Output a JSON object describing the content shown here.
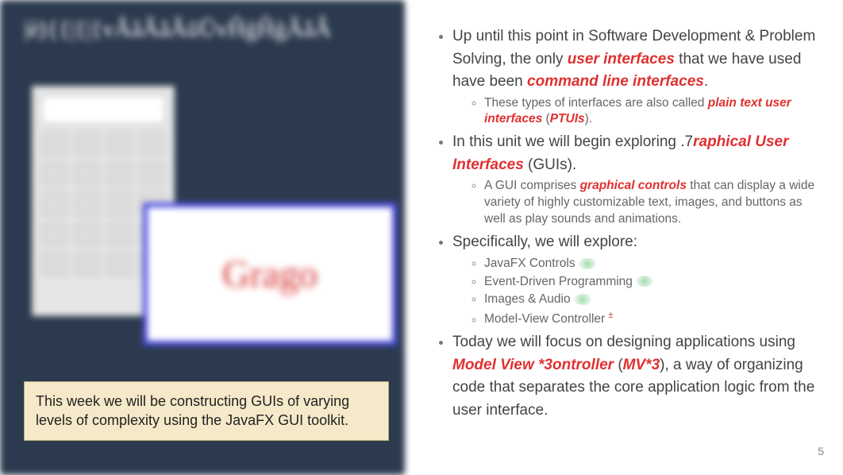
{
  "left": {
    "title": "|è⦆{{|{|{vĂăĂăĂūŪvĤģĤģĂăÂ",
    "caption": "This week we will be constructing GUIs of varying levels of complexity using the JavaFX GUI toolkit.",
    "logo_text": "Grago"
  },
  "right": {
    "b1_pre": "Up until this point in Software Development & Problem Solving, the only ",
    "b1_em1": "user interfaces",
    "b1_mid": " that we have used have been ",
    "b1_em2": "command line interfaces",
    "b1_post": ".",
    "b1_sub_pre": "These types of interfaces are also called ",
    "b1_sub_em": "plain text user interfaces",
    "b1_sub_par_open": " (",
    "b1_sub_em2": "PTUIs",
    "b1_sub_par_close": ").",
    "b2_pre": "In this unit we will begin exploring .7",
    "b2_em": "raphical User Interfaces",
    "b2_post": " (GUIs).",
    "b2_sub_pre": "A GUI comprises ",
    "b2_sub_em": "graphical controls",
    "b2_sub_post": " that can display a wide variety of highly customizable text, images, and buttons as well as play sounds and animations.",
    "b3": "Specifically, we will explore:",
    "b3_items": {
      "a": "JavaFX Controls",
      "b": "Event-Driven Programming",
      "c": "Images & Audio",
      "d": "Model-View Controller"
    },
    "b4_pre": "Today we will focus on designing applications using ",
    "b4_em1": "Model View *3ontroller",
    "b4_mid": " (",
    "b4_em2": "MV*3",
    "b4_post": ", a way of organizing code that separates the core application logic from the user interface."
  },
  "page_number": "5"
}
